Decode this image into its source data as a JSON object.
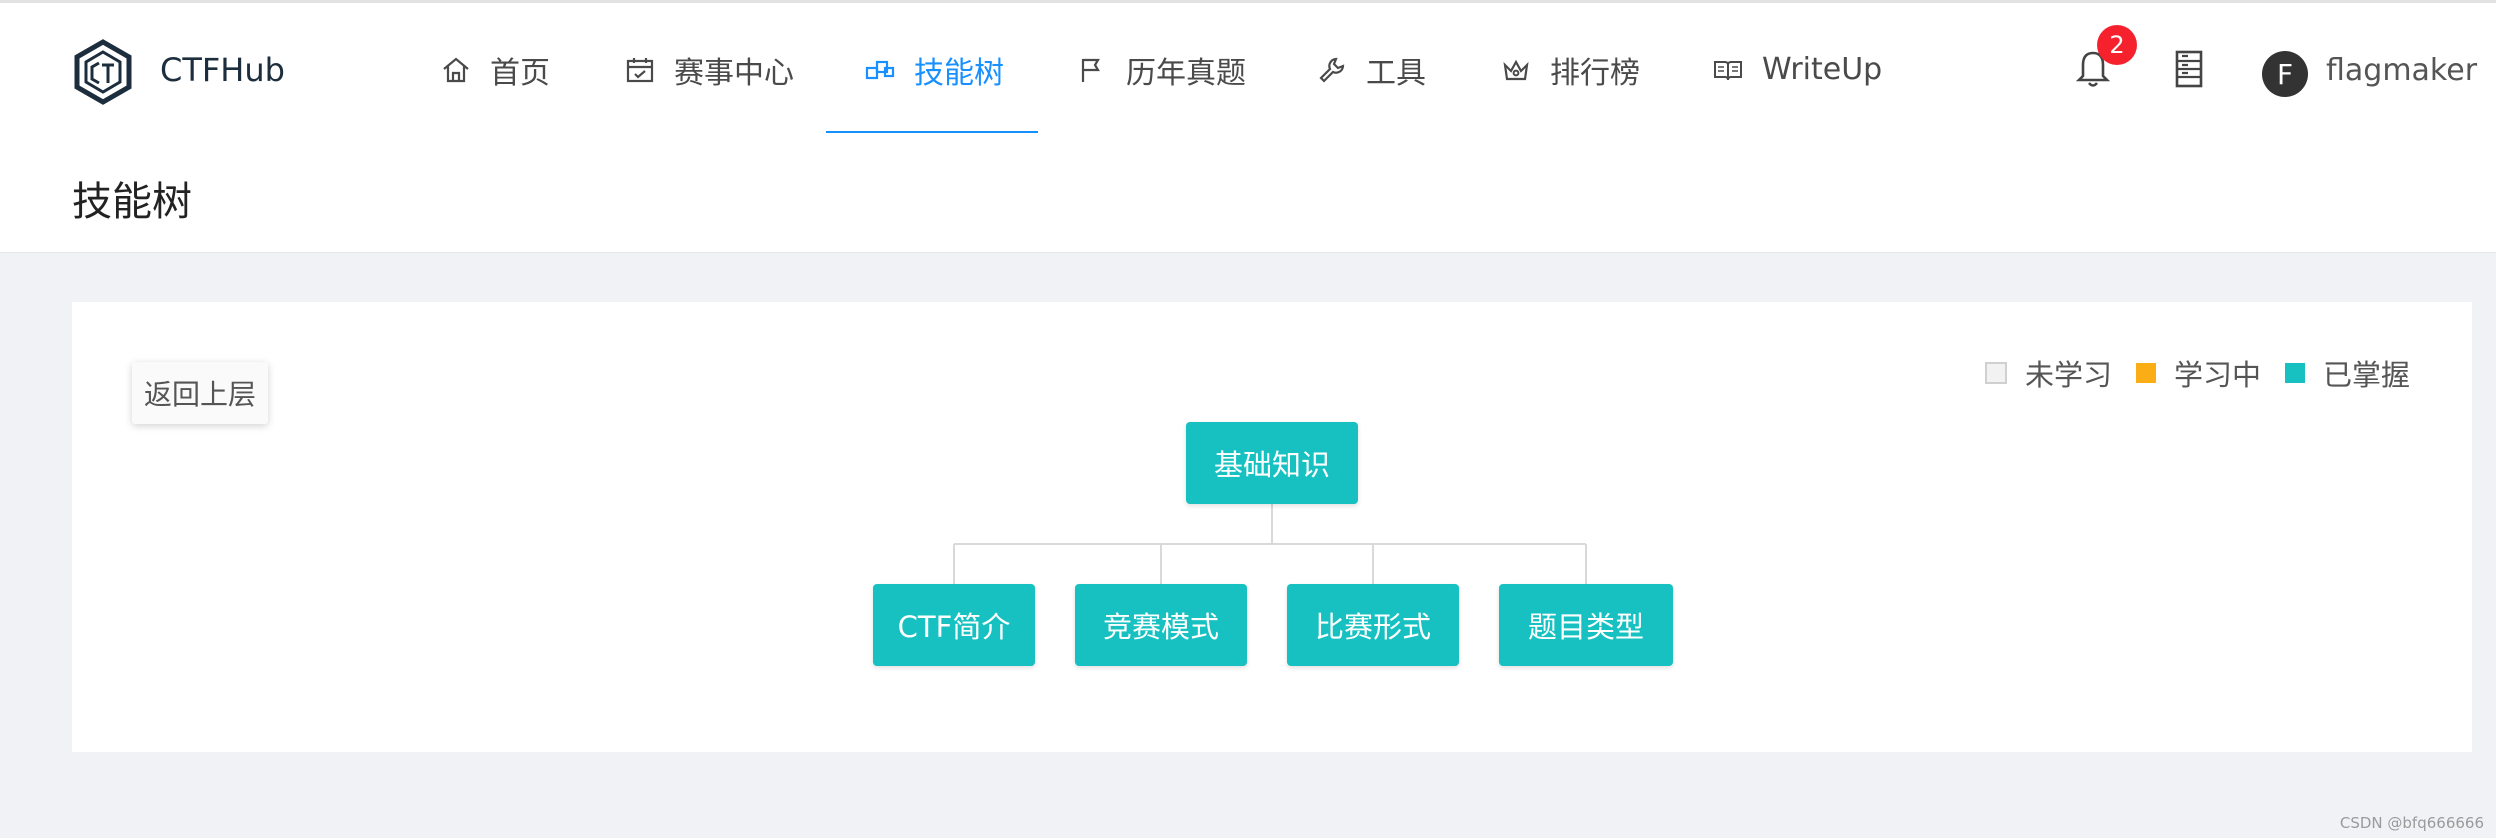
{
  "brand": {
    "name": "CTFHub"
  },
  "nav": {
    "items": [
      {
        "label": "首页",
        "icon": "home-icon"
      },
      {
        "label": "赛事中心",
        "icon": "calendar-icon"
      },
      {
        "label": "技能树",
        "icon": "skill-tree-icon",
        "active": true
      },
      {
        "label": "历年真题",
        "icon": "flag-icon"
      },
      {
        "label": "工具",
        "icon": "wrench-icon"
      },
      {
        "label": "排行榜",
        "icon": "crown-icon"
      },
      {
        "label": "WriteUp",
        "icon": "open-book-icon"
      }
    ]
  },
  "header": {
    "notification_count": "2",
    "avatar_letter": "F",
    "username": "flagmaker"
  },
  "page": {
    "title": "技能树"
  },
  "card": {
    "back_label": "返回上层",
    "legend": [
      {
        "label": "未学习",
        "color": "#e8e8e8"
      },
      {
        "label": "学习中",
        "color": "#faad14"
      },
      {
        "label": "已掌握",
        "color": "#17c1c1"
      }
    ],
    "tree": {
      "root": "基础知识",
      "children": [
        "CTF简介",
        "竞赛模式",
        "比赛形式",
        "题目类型"
      ]
    }
  },
  "colors": {
    "accent": "#1890ff",
    "mastered": "#17c1c1",
    "badge": "#f5222d"
  },
  "watermark": "CSDN @bfq666666"
}
